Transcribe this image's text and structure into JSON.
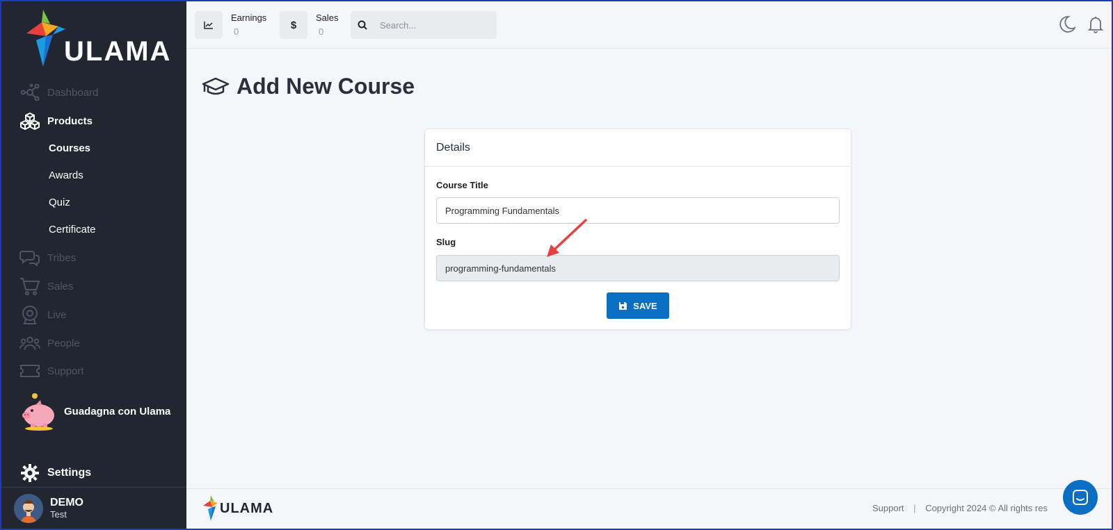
{
  "brand": {
    "name": "ULAMA"
  },
  "sidebar": {
    "items": [
      {
        "label": "Dashboard",
        "icon": "dashboard-icon"
      },
      {
        "label": "Products",
        "icon": "cubes-icon"
      },
      {
        "label": "Tribes",
        "icon": "chat-icon"
      },
      {
        "label": "Sales",
        "icon": "cart-icon"
      },
      {
        "label": "Live",
        "icon": "webcam-icon"
      },
      {
        "label": "People",
        "icon": "people-icon"
      },
      {
        "label": "Support",
        "icon": "ticket-icon"
      }
    ],
    "subitems": [
      {
        "label": "Courses"
      },
      {
        "label": "Awards"
      },
      {
        "label": "Quiz"
      },
      {
        "label": "Certificate"
      }
    ],
    "promo": "Guadagna con Ulama",
    "settings": "Settings",
    "user": {
      "name": "DEMO",
      "subtitle": "Test"
    }
  },
  "topbar": {
    "earnings": {
      "label": "Earnings",
      "value": "0"
    },
    "sales": {
      "label": "Sales",
      "value": "0",
      "icon_glyph": "$"
    },
    "search": {
      "placeholder": "Search..."
    }
  },
  "main": {
    "title": "Add New Course",
    "card": {
      "header": "Details",
      "course_title_label": "Course Title",
      "course_title_value": "Programming Fundamentals",
      "slug_label": "Slug",
      "slug_value": "programming-fundamentals",
      "save_label": "SAVE"
    }
  },
  "footer": {
    "support": "Support",
    "separator": "|",
    "copyright": "Copyright 2024 © All rights res"
  },
  "colors": {
    "sidebar_bg": "#222631",
    "accent": "#0a6fc2",
    "annotation_arrow": "#e8403f"
  }
}
